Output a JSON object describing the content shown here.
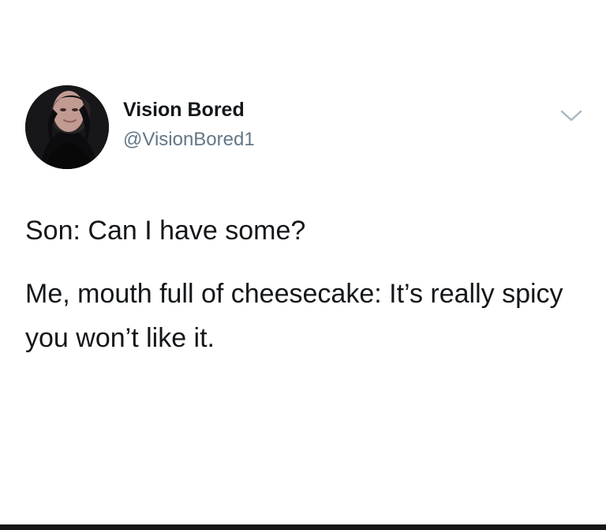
{
  "author": {
    "display_name": "Vision Bored",
    "handle": "@VisionBored1",
    "avatar_icon": "profile-photo-avatar"
  },
  "tweet": {
    "line_1": "Son: Can I have some?",
    "line_2": "Me, mouth full of cheesecake: It’s really spicy you won’t like it."
  },
  "controls": {
    "menu_icon": "chevron-down-icon"
  },
  "colors": {
    "primary_text": "#14171a",
    "secondary_text": "#657786",
    "background": "#ffffff",
    "caret": "#aab8c2"
  }
}
